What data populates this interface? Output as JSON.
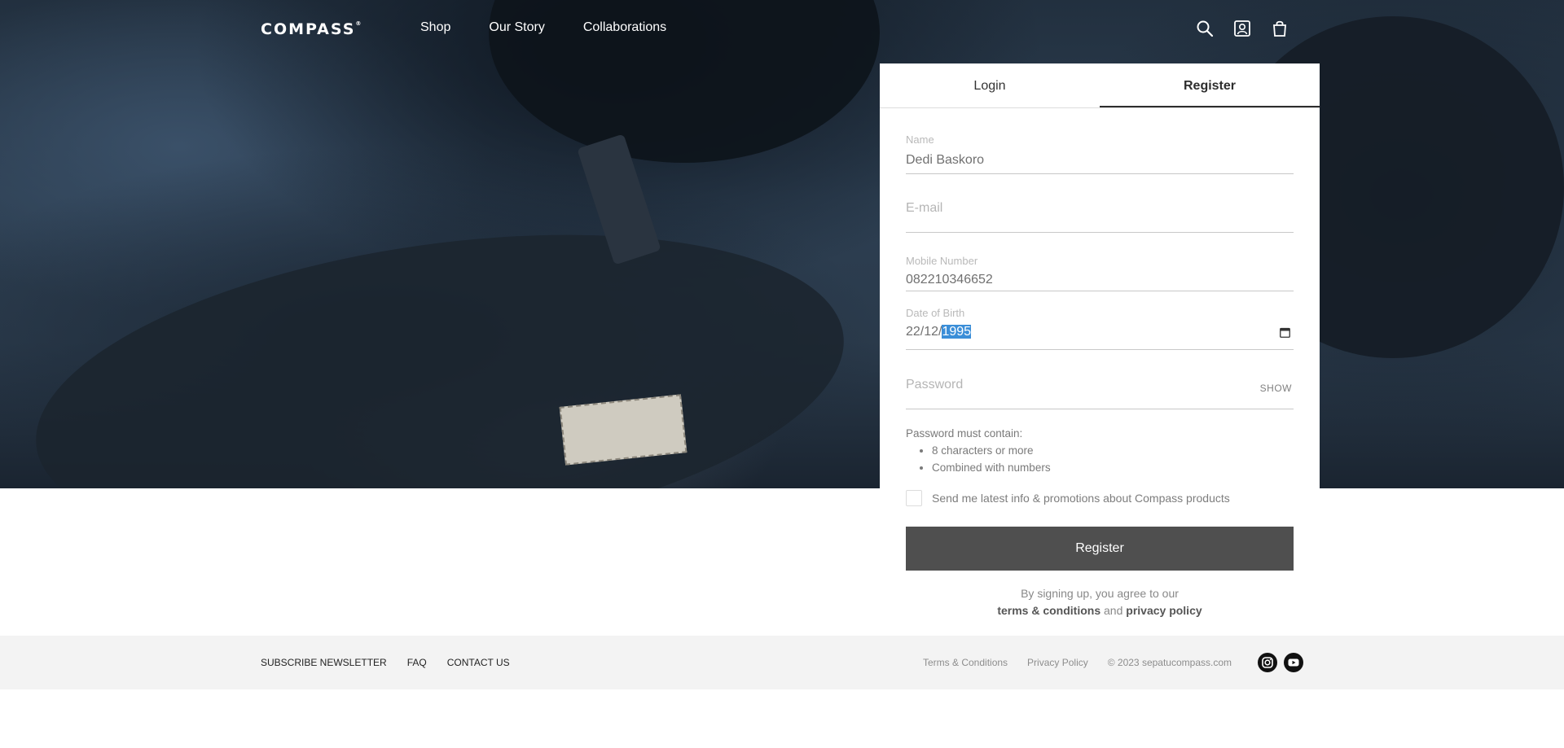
{
  "header": {
    "logo": "COMPASS",
    "logo_mark": "®",
    "nav": [
      {
        "label": "Shop"
      },
      {
        "label": "Our Story"
      },
      {
        "label": "Collaborations"
      }
    ],
    "icons": [
      "search-icon",
      "account-icon",
      "cart-icon"
    ]
  },
  "auth": {
    "tabs": [
      {
        "label": "Login",
        "active": false
      },
      {
        "label": "Register",
        "active": true
      }
    ],
    "fields": {
      "name": {
        "label": "Name",
        "value": "Dedi Baskoro"
      },
      "email": {
        "placeholder": "E-mail"
      },
      "mobile": {
        "label": "Mobile Number",
        "value": "082210346652"
      },
      "dob": {
        "label": "Date of Birth",
        "value_prefix": "22/12/",
        "value_selected": "1995"
      },
      "password": {
        "placeholder": "Password",
        "toggle": "SHOW"
      }
    },
    "password_rules": {
      "title": "Password must contain:",
      "items": [
        "8 characters or more",
        "Combined with numbers"
      ]
    },
    "optin_label": "Send me latest info & promotions about Compass products",
    "submit_label": "Register",
    "legal": {
      "line1": "By signing up, you agree to our",
      "terms": "terms & conditions",
      "and": "and",
      "privacy": "privacy policy"
    }
  },
  "footer": {
    "left_links": [
      "SUBSCRIBE NEWSLETTER",
      "FAQ",
      "CONTACT US"
    ],
    "right_links": [
      "Terms & Conditions",
      "Privacy Policy"
    ],
    "copyright": "© 2023 sepatucompass.com",
    "social": [
      "instagram-icon",
      "youtube-icon"
    ]
  },
  "colors": {
    "button": "#4f4f4f",
    "selection": "#3b8ed8",
    "footer_bg": "#f3f3f3"
  }
}
